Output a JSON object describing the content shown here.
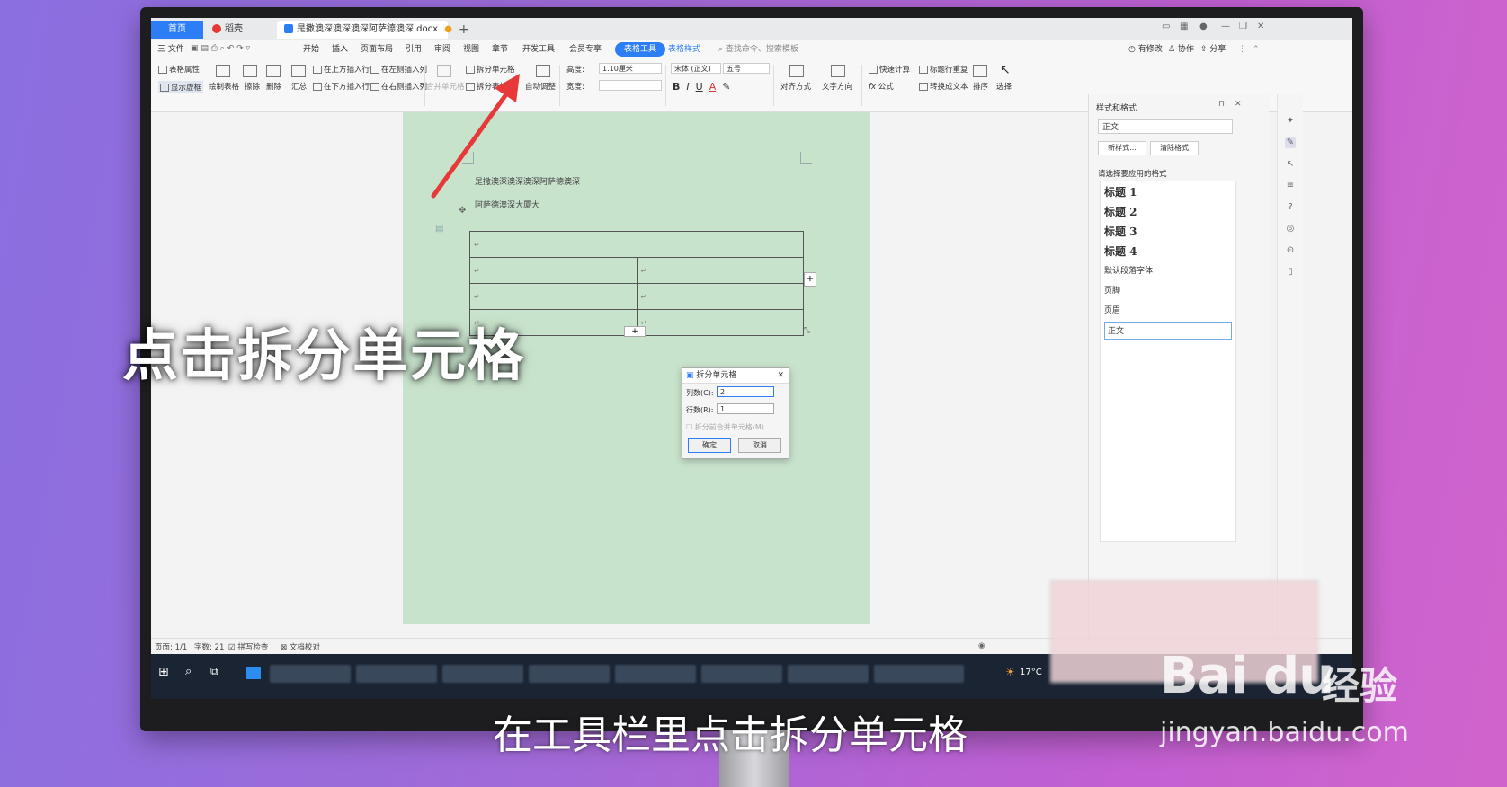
{
  "tabs": {
    "home": "首页",
    "shell": "稻壳",
    "document": "是撒澳深澳深澳深阿萨德澳深.docx",
    "add": "+"
  },
  "menubar": {
    "items": [
      "三 文件",
      "开始",
      "插入",
      "页面布局",
      "引用",
      "审阅",
      "视图",
      "章节",
      "开发工具",
      "会员专享",
      "表格工具",
      "表格样式"
    ],
    "search": "查找命令、搜索模板",
    "right": [
      "有修改",
      "协作",
      "分享"
    ]
  },
  "ribbon": {
    "table_props": "表格属性",
    "show_border": "显示虚框",
    "draw_table": "绘制表格",
    "erase": "擦除",
    "delete": "删除",
    "summary": "汇总",
    "insert_above": "在上方插入行",
    "insert_below": "在下方插入行",
    "insert_left": "在左侧插入列",
    "insert_right": "在右侧插入列",
    "merge_cells": "合并单元格",
    "split_cells": "拆分单元格",
    "split_table": "拆分表格",
    "auto_fit": "自动调整",
    "height_label": "高度:",
    "height_value": "1.10厘米",
    "width_label": "宽度:",
    "font_name": "宋体 (正文)",
    "font_size": "五号",
    "align": "对齐方式",
    "text_dir": "文字方向",
    "quick_calc": "快速计算",
    "formula": "公式",
    "repeat_header": "标题行重复",
    "to_text": "转换成文本",
    "sort": "排序",
    "select": "选择"
  },
  "document": {
    "line1": "是撒澳深澳深澳深阿萨德澳深",
    "line2": "阿萨德澳深大厦大",
    "cell_mark": "↵"
  },
  "dialog": {
    "title": "拆分单元格",
    "cols_label": "列数(C):",
    "cols_value": "2",
    "rows_label": "行数(R):",
    "rows_value": "1",
    "merge_first": "拆分前合并单元格(M)",
    "ok": "确定",
    "cancel": "取消"
  },
  "sidepanel": {
    "title": "样式和格式",
    "current_style": "正文",
    "new_style": "新样式...",
    "clear_format": "清除格式",
    "prompt": "请选择要应用的格式",
    "styles": [
      "标题 1",
      "标题 2",
      "标题 3",
      "标题 4",
      "默认段落字体",
      "页脚",
      "页眉",
      "正文"
    ]
  },
  "statusbar": {
    "page": "页面: 1/1",
    "words": "字数: 21",
    "spell": "拼写检查",
    "proof": "文档校对"
  },
  "taskbar": {
    "temperature": "17°C"
  },
  "overlay": {
    "big_caption": "点击拆分单元格",
    "subtitle": "在工具栏里点击拆分单元格",
    "watermark_logo": "Bai du",
    "watermark_jingyan": "经验",
    "watermark_url": "jingyan.baidu.com"
  },
  "colors": {
    "accent": "#2d7df6",
    "page_bg": "#c8e3cc",
    "arrow": "#e8393a"
  }
}
